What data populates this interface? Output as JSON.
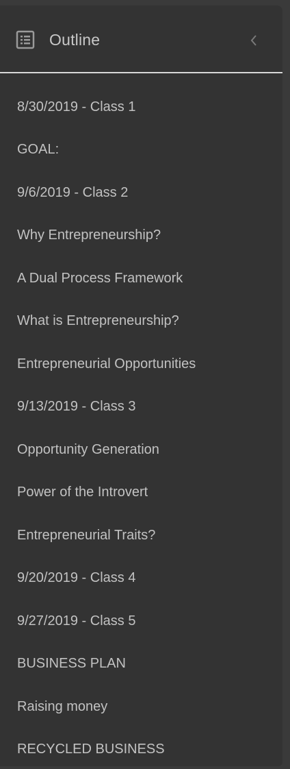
{
  "header": {
    "title": "Outline",
    "icon": "outline-list-icon",
    "collapse_icon": "chevron-left-icon"
  },
  "items": [
    {
      "label": "8/30/2019 - Class 1"
    },
    {
      "label": "GOAL:"
    },
    {
      "label": "9/6/2019 - Class 2"
    },
    {
      "label": "Why Entrepreneurship?"
    },
    {
      "label": "A Dual Process Framework"
    },
    {
      "label": "What is Entrepreneurship?"
    },
    {
      "label": "Entrepreneurial Opportunities"
    },
    {
      "label": "9/13/2019 - Class 3"
    },
    {
      "label": "Opportunity Generation"
    },
    {
      "label": "Power of the Introvert"
    },
    {
      "label": "Entrepreneurial Traits?"
    },
    {
      "label": "9/20/2019 - Class 4"
    },
    {
      "label": "9/27/2019 - Class 5"
    },
    {
      "label": "BUSINESS PLAN"
    },
    {
      "label": "Raising money"
    },
    {
      "label": "RECYCLED BUSINESS"
    }
  ],
  "colors": {
    "background": "#333333",
    "text": "#c2c2c2",
    "divider": "#d8d8d8"
  }
}
